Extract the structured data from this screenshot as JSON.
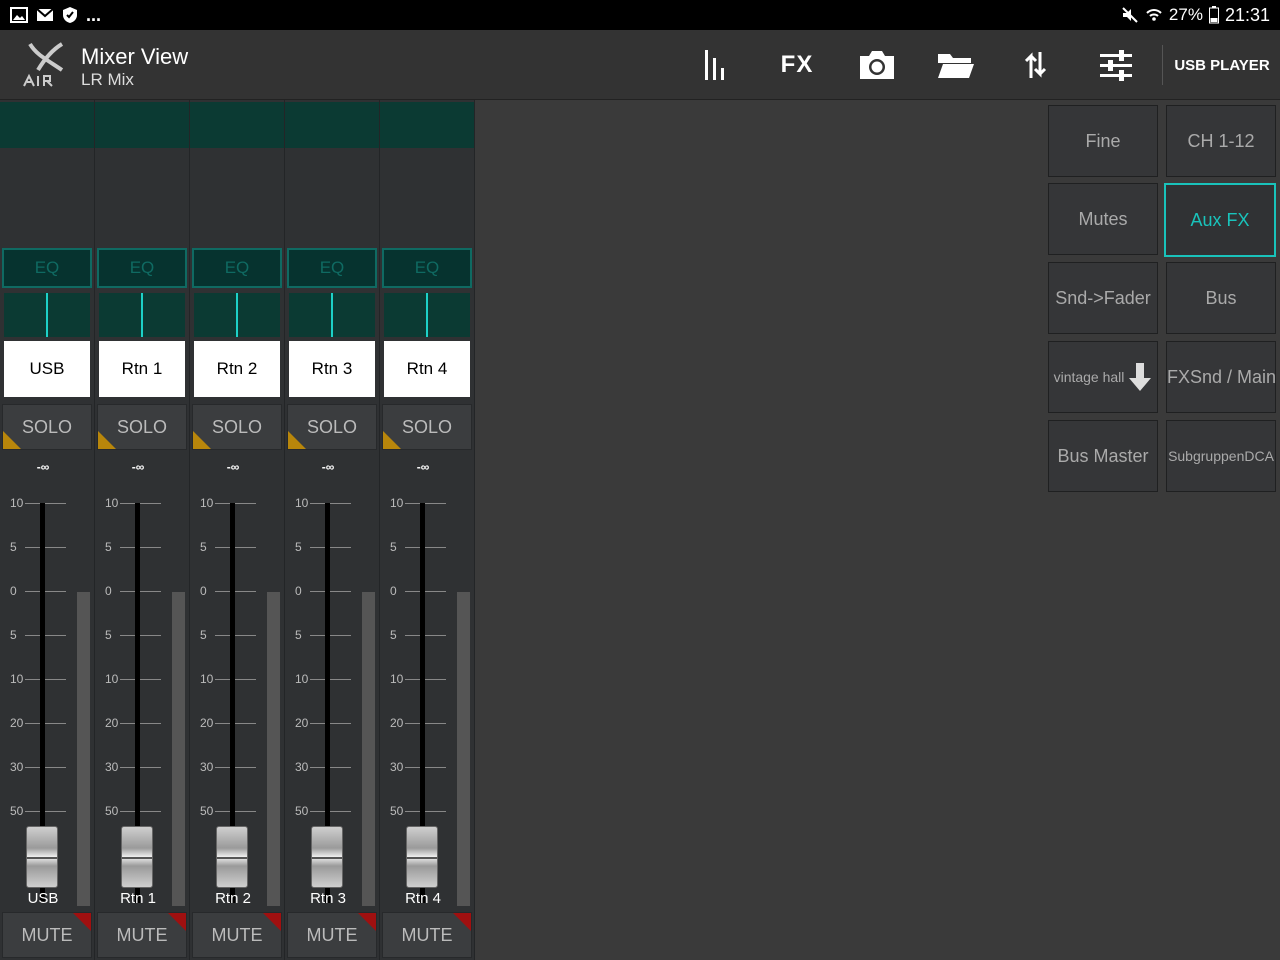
{
  "statusbar": {
    "dots": "...",
    "battery": "27%",
    "clock": "21:31"
  },
  "header": {
    "title": "Mixer View",
    "subtitle": "LR Mix",
    "fx_label": "FX",
    "usb_player": "USB PLAYER"
  },
  "strip_labels": {
    "eq": "EQ",
    "solo": "SOLO",
    "mute": "MUTE",
    "fader_value": "-∞"
  },
  "scale": [
    "10",
    "5",
    "0",
    "5",
    "10",
    "20",
    "30",
    "50"
  ],
  "channels": [
    {
      "name": "USB"
    },
    {
      "name": "Rtn 1"
    },
    {
      "name": "Rtn 2"
    },
    {
      "name": "Rtn 3"
    },
    {
      "name": "Rtn 4"
    }
  ],
  "grid": {
    "fine": "Fine",
    "ch_1_12": "CH 1-12",
    "mutes": "Mutes",
    "aux_fx": "Aux  FX",
    "snd_fader": "Snd->Fader",
    "bus": "Bus",
    "vintage_hall": "vintage hall",
    "fxsnd_main": "FXSnd / Main",
    "bus_master": "Bus Master",
    "subgruppen_dca": "SubgruppenDCA"
  },
  "colors": {
    "accent": "#19c3bb",
    "solo_marker": "#b8860b",
    "mute_marker": "#a01010"
  }
}
